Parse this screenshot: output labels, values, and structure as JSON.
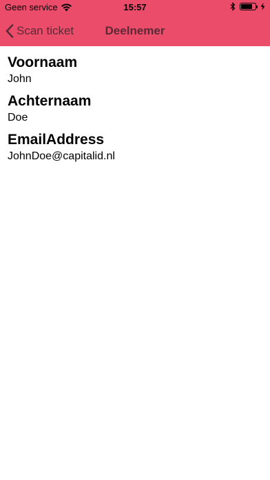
{
  "status_bar": {
    "carrier": "Geen service",
    "time": "15:57",
    "battery_level": 0.8
  },
  "nav": {
    "back_label": "Scan ticket",
    "title": "Deelnemer"
  },
  "fields": [
    {
      "label": "Voornaam",
      "value": "John"
    },
    {
      "label": "Achternaam",
      "value": "Doe"
    },
    {
      "label": "EmailAddress",
      "value": "JohnDoe@capitalid.nl"
    }
  ],
  "colors": {
    "header_background": "#ea4c6a",
    "nav_text": "#5b2a36"
  },
  "icons": {
    "wifi": "wifi-icon",
    "bluetooth": "bluetooth-icon",
    "battery": "battery-icon",
    "charging": "charging-icon",
    "back": "chevron-left-icon"
  }
}
